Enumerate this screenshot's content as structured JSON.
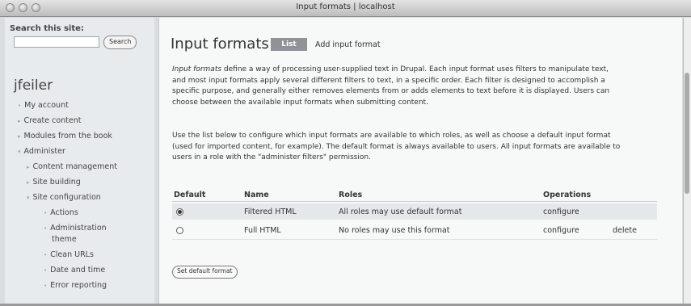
{
  "window": {
    "title": "Input formats | localhost"
  },
  "sidebar": {
    "search_title": "Search this site:",
    "search_button": "Search",
    "username": "jfeiler",
    "items": [
      {
        "label": "My account"
      },
      {
        "label": "Create content"
      },
      {
        "label": "Modules from the book"
      },
      {
        "label": "Administer"
      },
      {
        "label": "Content management"
      },
      {
        "label": "Site building"
      },
      {
        "label": "Site configuration"
      },
      {
        "label": "Actions"
      },
      {
        "label": "Administration"
      },
      {
        "label": "theme"
      },
      {
        "label": "Clean URLs"
      },
      {
        "label": "Date and time"
      },
      {
        "label": "Error reporting"
      }
    ]
  },
  "main": {
    "title": "Input formats",
    "tabs": [
      {
        "label": "List"
      },
      {
        "label": "Add input format"
      }
    ],
    "para1_em": "Input formats",
    "para1_lines": [
      " define a way of processing user-supplied text in Drupal. Each input format uses filters to manipulate text,",
      "and most input formats apply several different filters to text, in a specific order. Each filter is designed to accomplish a",
      "specific purpose, and generally either removes elements from or adds elements to text before it is displayed. Users can",
      "choose between the available input formats when submitting content."
    ],
    "para2_lines": [
      "Use the list below to configure which input formats are available to which roles, as well as choose a default input format",
      "(used for imported content, for example). The default format is always available to users. All input formats are available to",
      "users in a role with the \"administer filters\" permission."
    ],
    "table": {
      "headers": [
        "Default",
        "Name",
        "Roles",
        "Operations"
      ],
      "rows": [
        {
          "name": "Filtered HTML",
          "roles": "All roles may use default format",
          "op1": "configure",
          "op2": ""
        },
        {
          "name": "Full HTML",
          "roles": "No roles may use this format",
          "op1": "configure",
          "op2": "delete"
        }
      ]
    },
    "set_default_button": "Set default format"
  }
}
